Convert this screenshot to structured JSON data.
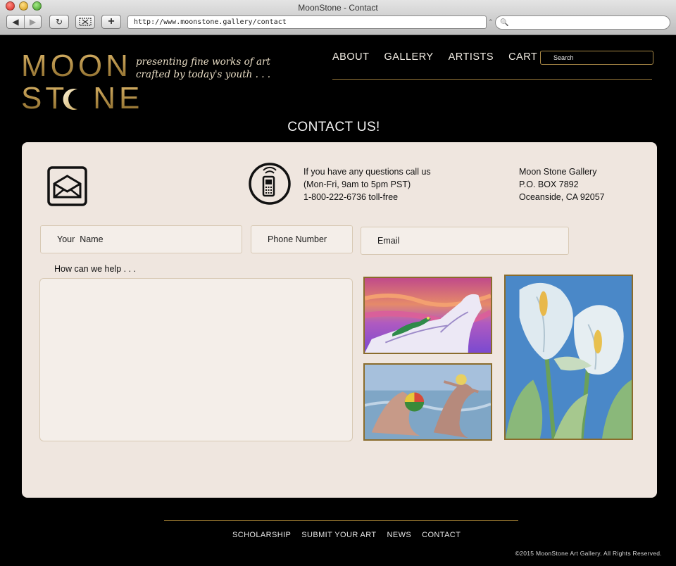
{
  "browser": {
    "window_title": "MoonStone - Contact",
    "url": "http://www.moonstone.gallery/contact",
    "reload_glyph": "↻",
    "add_glyph": "+",
    "back_glyph": "◀",
    "forward_glyph": "▶",
    "search_glyph": "🔍"
  },
  "site": {
    "logo_line1": "MOON",
    "logo_line2_a": "ST",
    "logo_line2_b": "NE",
    "tagline_line1": "presenting fine works of art",
    "tagline_line2": "crafted by today's youth  . . .",
    "brand_color": "#b08a3e",
    "nav": [
      {
        "label": "ABOUT"
      },
      {
        "label": "GALLERY"
      },
      {
        "label": "ARTISTS"
      },
      {
        "label": "CART"
      }
    ],
    "search_placeholder": "Search"
  },
  "page": {
    "heading": "CONTACT US!"
  },
  "contact": {
    "call_line1": "If you have any questions call us",
    "call_line2": "(Mon-Fri, 9am to 5pm PST)",
    "call_line3": "1-800-222-6736  toll-free",
    "addr_line1": "Moon Stone Gallery",
    "addr_line2": "P.O. BOX 7892",
    "addr_line3": "Oceanside, CA 92057",
    "name_placeholder": "Your  Name",
    "phone_placeholder": "Phone Number",
    "email_placeholder": "Email",
    "help_label": "How can we help . . ."
  },
  "footer": {
    "links": [
      {
        "label": "SCHOLARSHIP"
      },
      {
        "label": "SUBMIT YOUR ART"
      },
      {
        "label": "NEWS"
      },
      {
        "label": "CONTACT"
      }
    ],
    "copyright": "©2015 MoonStone Art Gallery. All Rights Reserved."
  }
}
